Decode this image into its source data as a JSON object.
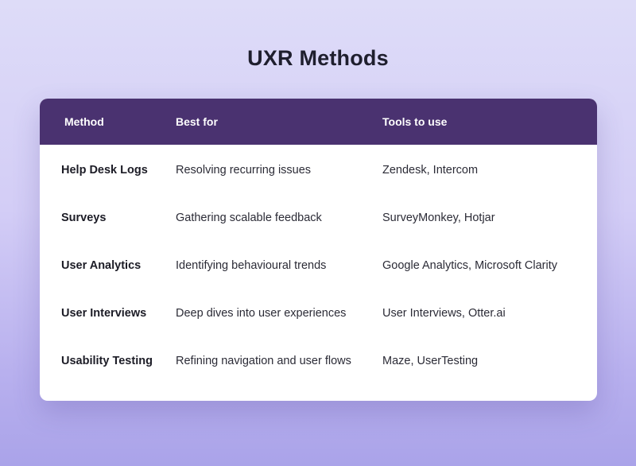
{
  "title": "UXR Methods",
  "table": {
    "columns": [
      "Method",
      "Best for",
      "Tools to use"
    ],
    "rows": [
      {
        "method": "Help Desk Logs",
        "best_for": "Resolving recurring issues",
        "tools": "Zendesk, Intercom"
      },
      {
        "method": "Surveys",
        "best_for": "Gathering scalable feedback",
        "tools": "SurveyMonkey, Hotjar"
      },
      {
        "method": "User Analytics",
        "best_for": "Identifying behavioural trends",
        "tools": "Google Analytics, Microsoft Clarity"
      },
      {
        "method": "User Interviews",
        "best_for": "Deep dives into user experiences",
        "tools": "User Interviews, Otter.ai"
      },
      {
        "method": "Usability Testing",
        "best_for": "Refining navigation and user flows",
        "tools": "Maze, UserTesting"
      }
    ]
  },
  "colors": {
    "header_bg": "#4a3270",
    "background_top": "#dedcf8",
    "background_bottom": "#aaa3e9"
  }
}
